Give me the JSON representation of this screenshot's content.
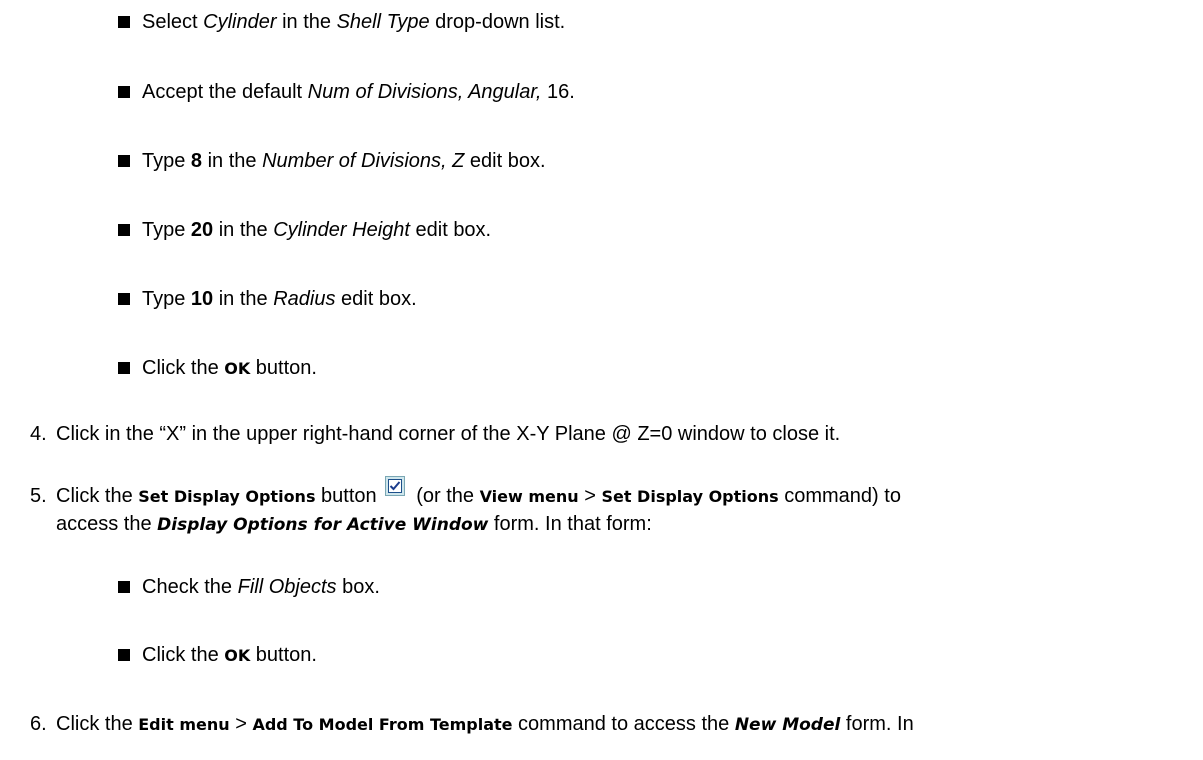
{
  "bullets": [
    {
      "pre": "Select ",
      "em1": "Cylinder",
      "mid": " in the ",
      "em2": "Shell Type",
      "post": " drop-down list."
    },
    {
      "pre": "Accept the default ",
      "em1": "Num of Divisions, Angular,",
      "post": " 16."
    },
    {
      "pre": "Type ",
      "val": "8",
      "mid": " in the ",
      "em1": "Number of Divisions, Z",
      "post": " edit box."
    },
    {
      "pre": "Type ",
      "val": "20",
      "mid": " in the ",
      "em1": "Cylinder Height",
      "post": " edit box."
    },
    {
      "pre": "Type ",
      "val": "10",
      "mid": " in the ",
      "em1": "Radius",
      "post": " edit box."
    },
    {
      "pre": "Click the ",
      "ui": "OK",
      "post": " button."
    }
  ],
  "step4": {
    "num": "4.",
    "text": "Click in the “X” in the upper right-hand corner of the X-Y Plane @ Z=0 window to close it."
  },
  "step5": {
    "num": "5.",
    "pre": "Click the ",
    "ui1": "Set Display Options",
    "mid1": " button",
    "mid2": " (or the ",
    "ui2": "View menu",
    "gt": " > ",
    "ui3": "Set Display Options",
    "post1": " command) to",
    "line2_pre": "access the ",
    "form": "Display Options for Active Window",
    "line2_post": " form. In that form:",
    "icon": "display-options-checkbox-icon"
  },
  "step5_bullets": [
    {
      "pre": "Check the ",
      "em1": "Fill Objects",
      "post": " box."
    },
    {
      "pre": "Click the ",
      "ui": "OK",
      "post": " button."
    }
  ],
  "step6": {
    "num": "6.",
    "pre": "Click the ",
    "ui1": "Edit menu",
    "gt": " > ",
    "ui2": "Add To Model From Template",
    "mid": " command to access the ",
    "form": "New Model",
    "post": " form. In"
  }
}
